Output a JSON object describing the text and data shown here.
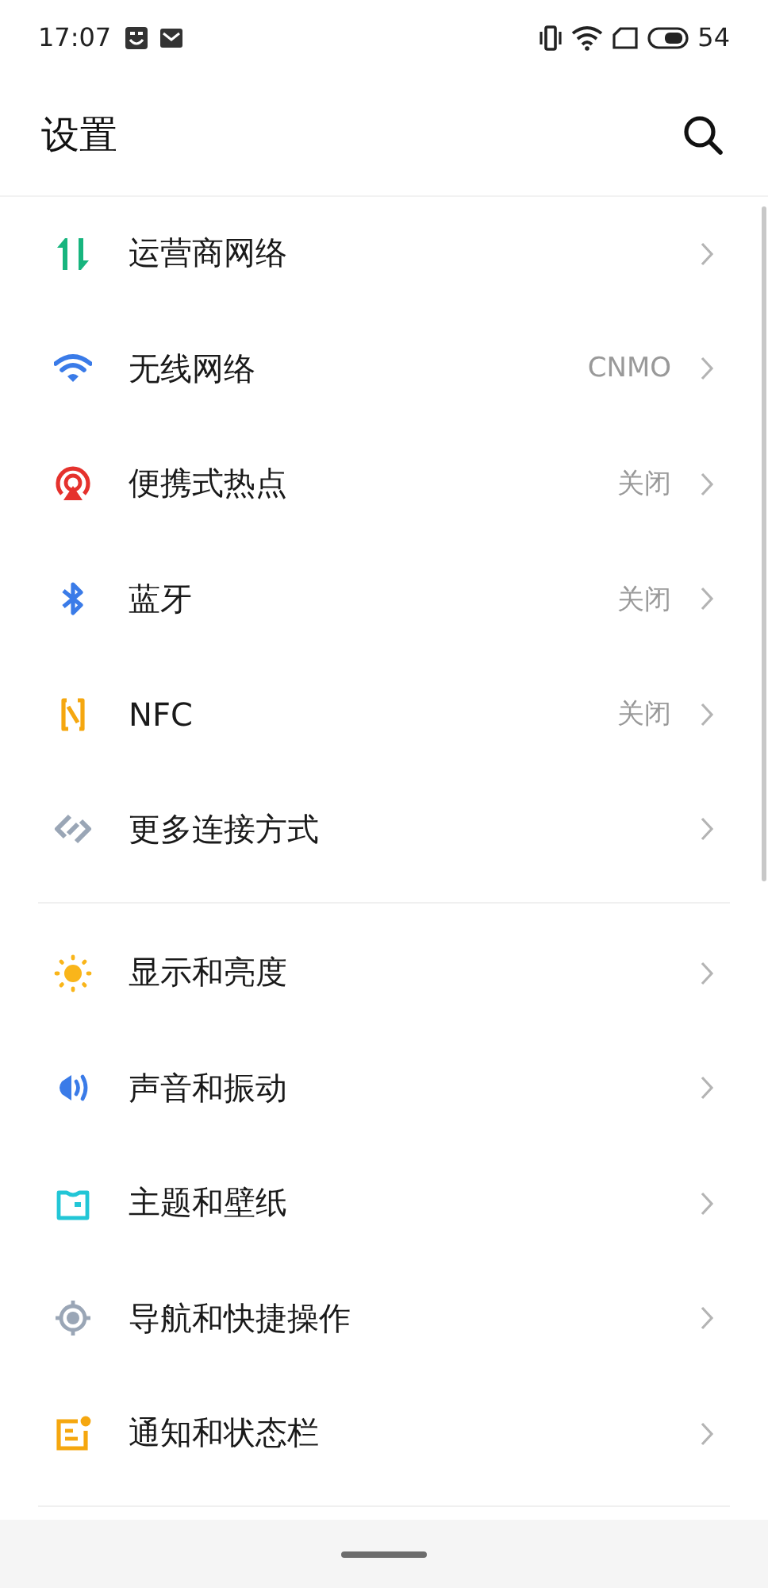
{
  "status_bar": {
    "time": "17:07",
    "battery": "54"
  },
  "header": {
    "title": "设置"
  },
  "sections": [
    {
      "items": [
        {
          "label": "运营商网络"
        },
        {
          "label": "无线网络",
          "value": "CNMO"
        },
        {
          "label": "便携式热点",
          "value": "关闭"
        },
        {
          "label": "蓝牙",
          "value": "关闭"
        },
        {
          "label": "NFC",
          "value": "关闭"
        },
        {
          "label": "更多连接方式"
        }
      ]
    },
    {
      "items": [
        {
          "label": "显示和亮度"
        },
        {
          "label": "声音和振动"
        },
        {
          "label": "主题和壁纸"
        },
        {
          "label": "导航和快捷操作"
        },
        {
          "label": "通知和状态栏"
        }
      ]
    }
  ]
}
